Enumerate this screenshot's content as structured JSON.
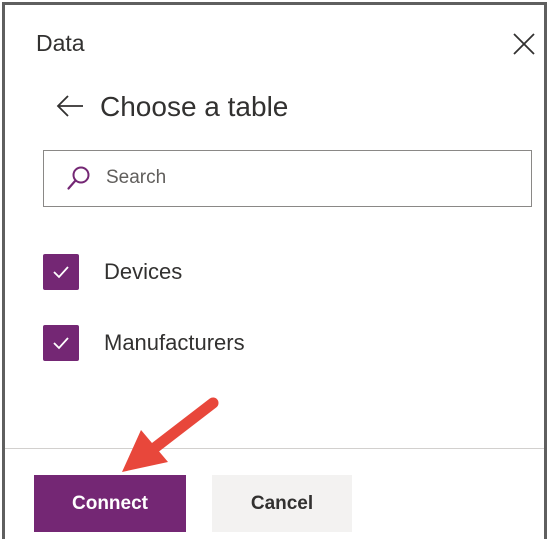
{
  "panel": {
    "title": "Data"
  },
  "header": {
    "heading": "Choose a table"
  },
  "search": {
    "placeholder": "Search",
    "value": ""
  },
  "tables": [
    {
      "label": "Devices",
      "checked": true
    },
    {
      "label": "Manufacturers",
      "checked": true
    }
  ],
  "footer": {
    "connect_label": "Connect",
    "cancel_label": "Cancel"
  },
  "colors": {
    "accent": "#742774",
    "annotation_arrow": "#e8473b",
    "secondary_button": "#f3f2f1"
  },
  "icons": {
    "close": "close-icon",
    "back": "arrow-left-icon",
    "search": "search-icon",
    "check": "checkmark-icon"
  }
}
